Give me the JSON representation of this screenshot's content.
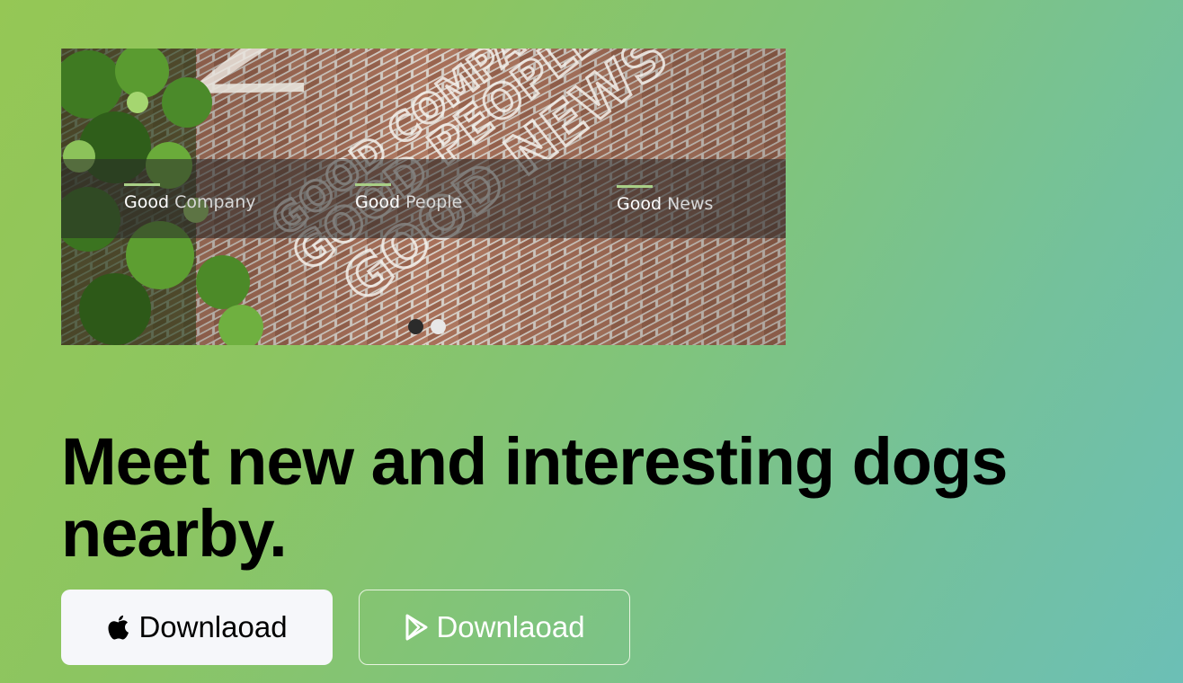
{
  "carousel": {
    "slides": [
      {
        "strong": "Good",
        "rest": "Company"
      },
      {
        "strong": "Good",
        "rest": "People"
      },
      {
        "strong": "Good",
        "rest": "News"
      }
    ],
    "dots": [
      {
        "state": "active"
      },
      {
        "state": "inactive"
      }
    ],
    "wall_text": [
      "GOOD COMPANY",
      "GOOD PEOPLE",
      "GOOD NEWS"
    ]
  },
  "hero": {
    "headline": "Meet new and interesting dogs nearby."
  },
  "buttons": {
    "apple": {
      "label": "Downlaoad",
      "icon": "apple-icon"
    },
    "play": {
      "label": "Downlaoad",
      "icon": "play-store-icon"
    }
  },
  "colors": {
    "gradient_start": "#95c755",
    "gradient_end": "#6cbfb6",
    "caption_accent": "#a9cf86",
    "apple_button_bg": "#f6f7fa"
  }
}
